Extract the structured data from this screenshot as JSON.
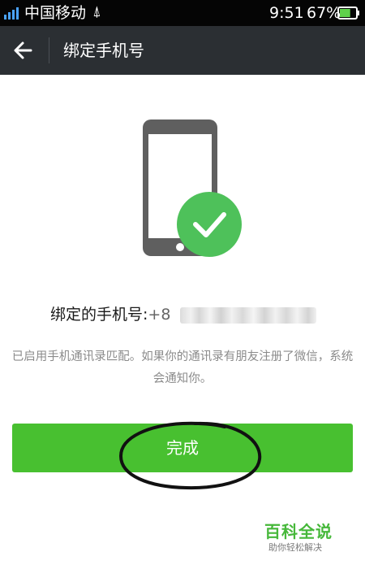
{
  "status_bar": {
    "carrier": "中国移动",
    "time": "9:51",
    "battery_percent": "67%",
    "battery_level": 0.67,
    "usb_icon_glyph": "⍋"
  },
  "header": {
    "title": "绑定手机号",
    "back_icon": "arrow-left-icon"
  },
  "illustration": {
    "icon": "phone-check-icon",
    "phone_color": "#5f5f5f",
    "check_color": "#4ec15a"
  },
  "binding": {
    "label": "绑定的手机号: ",
    "number": "+8"
  },
  "info_text": "已启用手机通讯录匹配。如果你的通讯录有朋友注册了微信，系统会通知你。",
  "done_button": {
    "label": "完成",
    "color": "#48c030"
  },
  "watermark": {
    "title": "百科全说",
    "subtitle": "助你轻松解决"
  }
}
